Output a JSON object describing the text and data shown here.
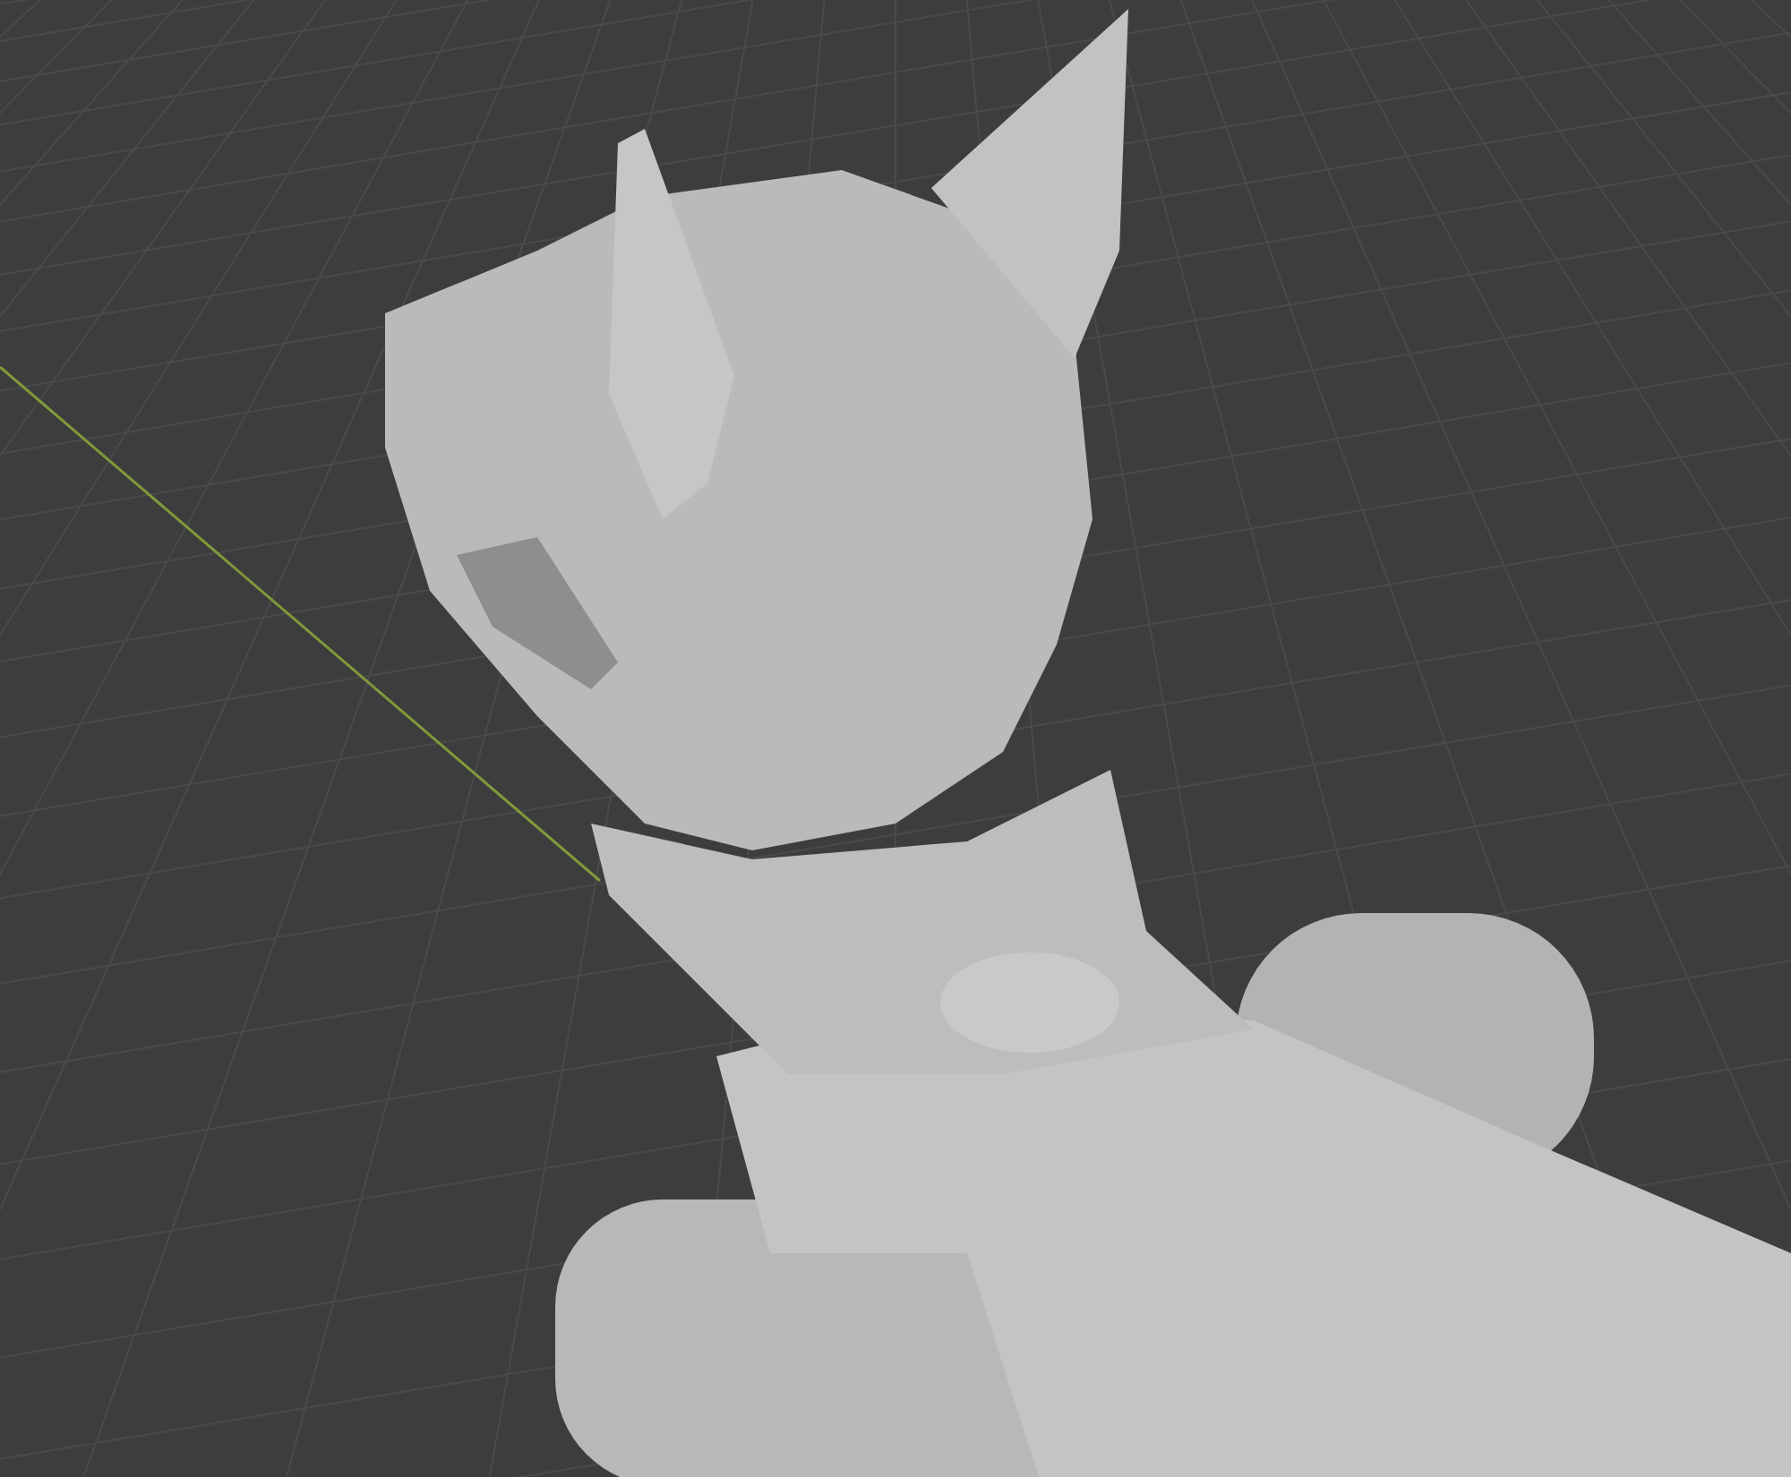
{
  "viewport": {
    "grid": true,
    "x_axis": true,
    "model": {
      "kind": "sculpt"
    }
  }
}
